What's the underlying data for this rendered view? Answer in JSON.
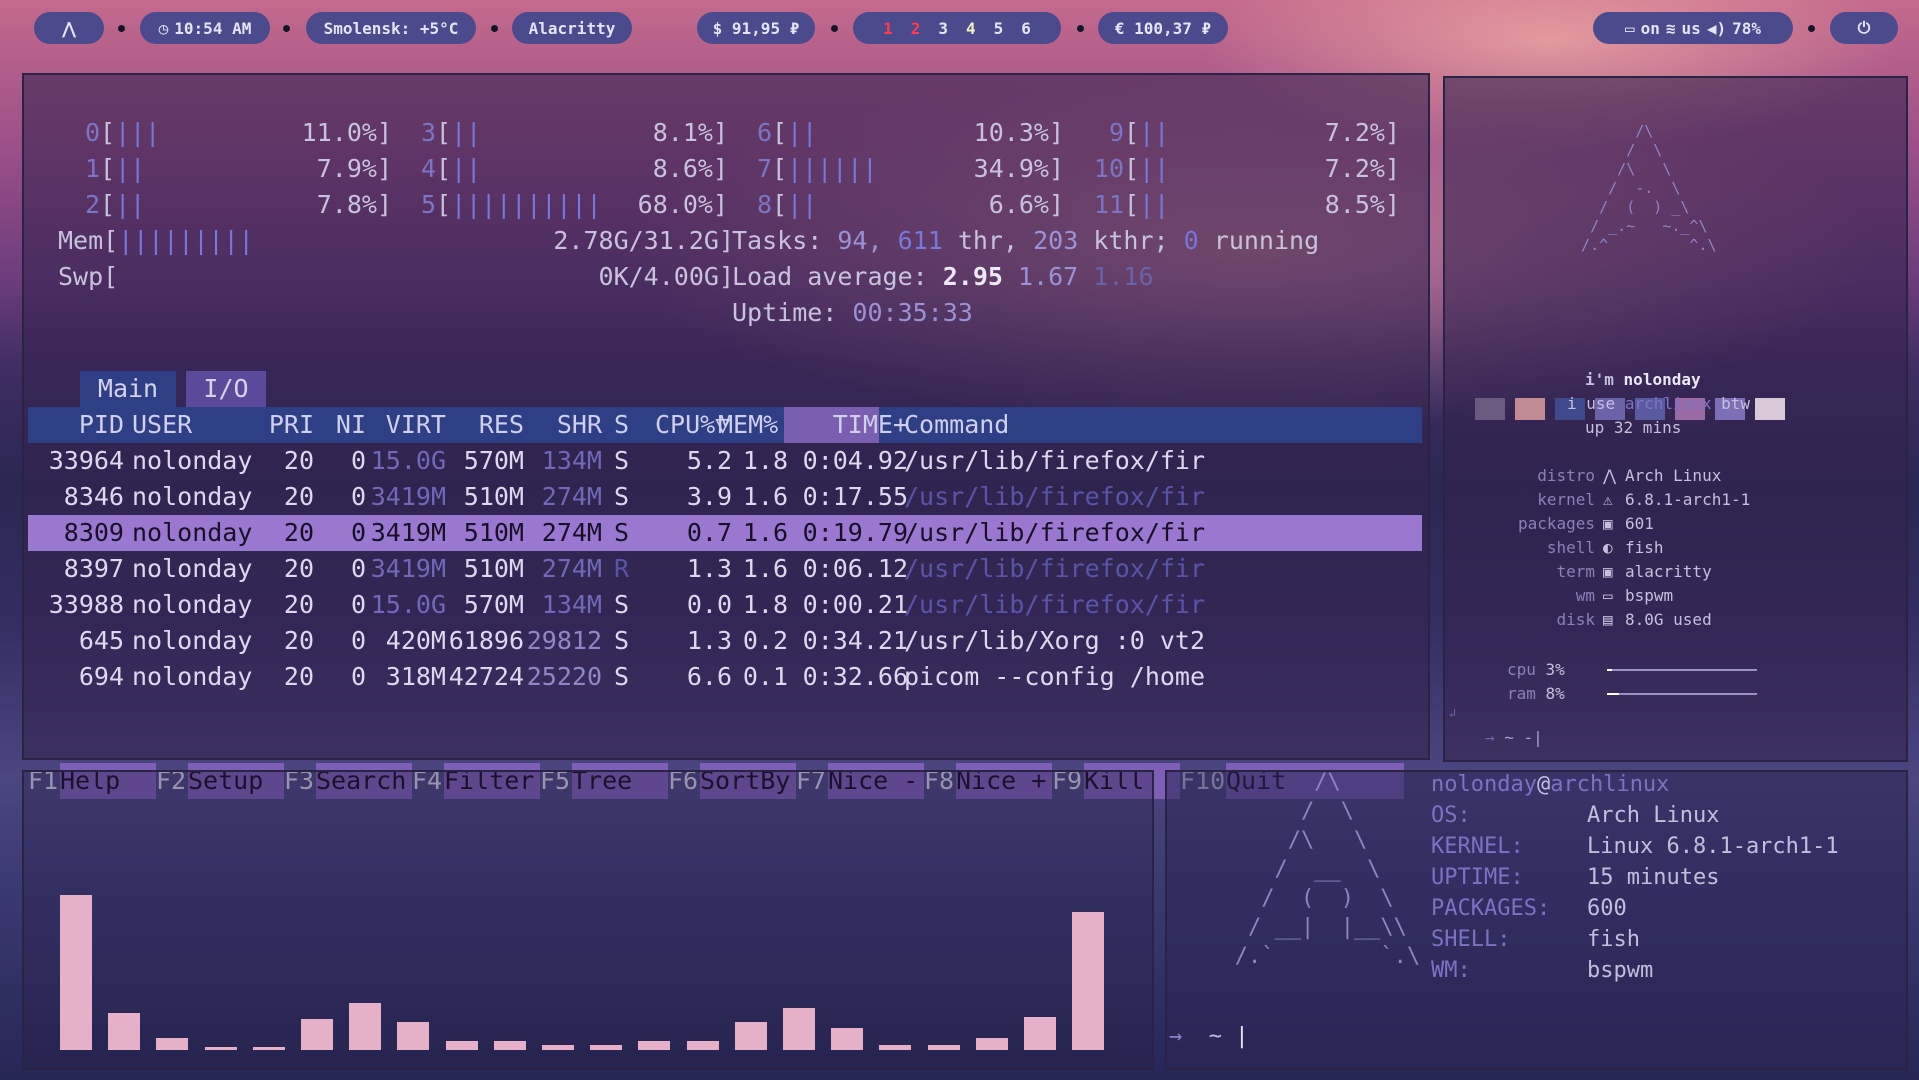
{
  "topbar": {
    "logo": "⋀",
    "clock": "10:54 AM",
    "weather": "Smolensk: +5°C",
    "window_title": "Alacritty",
    "usd": "$ 91,95 ₽",
    "workspaces": [
      "1",
      "2",
      "3",
      "4",
      "5",
      "6"
    ],
    "eur": "€ 100,37 ₽",
    "status": {
      "kbd": "on",
      "layout": "us",
      "volume": "78%"
    },
    "power": "⏻"
  },
  "htop": {
    "cpus": [
      {
        "id": "0",
        "bars": "|||",
        "pct": "11.0%"
      },
      {
        "id": "1",
        "bars": "||",
        "pct": "7.9%"
      },
      {
        "id": "2",
        "bars": "||",
        "pct": "7.8%"
      },
      {
        "id": "3",
        "bars": "||",
        "pct": "8.1%"
      },
      {
        "id": "4",
        "bars": "||",
        "pct": "8.6%"
      },
      {
        "id": "5",
        "bars": "||||||||||",
        "pct": "68.0%"
      },
      {
        "id": "6",
        "bars": "||",
        "pct": "10.3%"
      },
      {
        "id": "7",
        "bars": "||||||",
        "pct": "34.9%"
      },
      {
        "id": "8",
        "bars": "||",
        "pct": "6.6%"
      },
      {
        "id": "9",
        "bars": "||",
        "pct": "7.2%"
      },
      {
        "id": "10",
        "bars": "||",
        "pct": "7.2%"
      },
      {
        "id": "11",
        "bars": "||",
        "pct": "8.5%"
      }
    ],
    "mem_label": "Mem",
    "mem_bars": "|||||||||",
    "mem_val": "2.78G/31.2G",
    "swp_label": "Swp",
    "swp_val": "0K/4.00G",
    "tasks_label": "Tasks:",
    "tasks": "94,",
    "thr": "611",
    "thr_label": "thr,",
    "kthr": "203",
    "kthr_label": "kthr;",
    "running": "0",
    "running_label": "running",
    "load_label": "Load average:",
    "load1": "2.95",
    "load5": "1.67",
    "load15": "1.16",
    "uptime_label": "Uptime:",
    "uptime": "00:35:33",
    "tabs": [
      "Main",
      "I/O"
    ],
    "columns": [
      "PID",
      "USER",
      "PRI",
      "NI",
      "VIRT",
      "RES",
      "SHR",
      "S",
      "CPU%▽",
      "MEM%",
      "TIME+",
      "Command"
    ],
    "rows": [
      [
        "33964",
        "nolonday",
        "20",
        "0",
        "15.0G",
        "570M",
        "134M",
        "S",
        "5.2",
        "1.8",
        "0:04.92",
        "/usr/lib/firefox/fir"
      ],
      [
        "8346",
        "nolonday",
        "20",
        "0",
        "3419M",
        "510M",
        "274M",
        "S",
        "3.9",
        "1.6",
        "0:17.55",
        "/usr/lib/firefox/fir"
      ],
      [
        "8309",
        "nolonday",
        "20",
        "0",
        "3419M",
        "510M",
        "274M",
        "S",
        "0.7",
        "1.6",
        "0:19.79",
        "/usr/lib/firefox/fir"
      ],
      [
        "8397",
        "nolonday",
        "20",
        "0",
        "3419M",
        "510M",
        "274M",
        "R",
        "1.3",
        "1.6",
        "0:06.12",
        "/usr/lib/firefox/fir"
      ],
      [
        "33988",
        "nolonday",
        "20",
        "0",
        "15.0G",
        "570M",
        "134M",
        "S",
        "0.0",
        "1.8",
        "0:00.21",
        "/usr/lib/firefox/fir"
      ],
      [
        "645",
        "nolonday",
        "20",
        "0",
        "420M",
        "61896",
        "29812",
        "S",
        "1.3",
        "0.2",
        "0:34.21",
        "/usr/lib/Xorg :0 vt2"
      ],
      [
        "694",
        "nolonday",
        "20",
        "0",
        "318M",
        "42724",
        "25220",
        "S",
        "6.6",
        "0.1",
        "0:32.66",
        "picom --config /home"
      ]
    ],
    "fkeys": [
      {
        "k": "F1",
        "n": "Help"
      },
      {
        "k": "F2",
        "n": "Setup"
      },
      {
        "k": "F3",
        "n": "Search"
      },
      {
        "k": "F4",
        "n": "Filter"
      },
      {
        "k": "F5",
        "n": "Tree"
      },
      {
        "k": "F6",
        "n": "SortBy"
      },
      {
        "k": "F7",
        "n": "Nice -"
      },
      {
        "k": "F8",
        "n": "Nice +"
      },
      {
        "k": "F9",
        "n": "Kill"
      },
      {
        "k": "F10",
        "n": "Quit"
      }
    ]
  },
  "sysinfo": {
    "im": "i'm",
    "user": "nolonday",
    "iuse": "i use",
    "distro_word": "archlinux",
    "btw": "btw",
    "up": "up",
    "mins": "32 mins",
    "fields": [
      {
        "label": "distro",
        "icon": "⋀",
        "value": "Arch Linux"
      },
      {
        "label": "kernel",
        "icon": "⚠",
        "value": "6.8.1-arch1-1"
      },
      {
        "label": "packages",
        "icon": "▣",
        "value": "601"
      },
      {
        "label": "shell",
        "icon": "◐",
        "value": "fish"
      },
      {
        "label": "term",
        "icon": "▣",
        "value": "alacritty"
      },
      {
        "label": "wm",
        "icon": "▭",
        "value": "bspwm"
      },
      {
        "label": "disk",
        "icon": "▤",
        "value": "8.0G used"
      }
    ],
    "cpu_label": "cpu",
    "cpu": "3%",
    "ram_label": "ram",
    "ram": "8%",
    "prompt": "~ -",
    "swatches": [
      "#6a5a80",
      "#c08b92",
      "#3e4a8c",
      "#6c62a8",
      "#5a5aa0",
      "#9a6aa4",
      "#7d6fb6",
      "#d8c8d8"
    ],
    "cpu_level": 0.03,
    "ram_level": 0.08
  },
  "visualizer": {
    "values": [
      100,
      24,
      8,
      2,
      2,
      20,
      30,
      18,
      6,
      6,
      3,
      3,
      6,
      6,
      18,
      27,
      14,
      3,
      3,
      8,
      21,
      89
    ]
  },
  "fetch": {
    "userhost_user": "nolonday",
    "userhost_at": "@",
    "userhost_host": "archlinux",
    "items": [
      {
        "k": "OS:",
        "v": "Arch Linux"
      },
      {
        "k": "KERNEL:",
        "v": "Linux 6.8.1-arch1-1"
      },
      {
        "k": "UPTIME:",
        "v": "15 minutes"
      },
      {
        "k": "PACKAGES:",
        "v": "600"
      },
      {
        "k": "SHELL:",
        "v": "fish"
      },
      {
        "k": "WM:",
        "v": "bspwm"
      }
    ],
    "prompt_arrow": "→",
    "prompt": "~"
  }
}
